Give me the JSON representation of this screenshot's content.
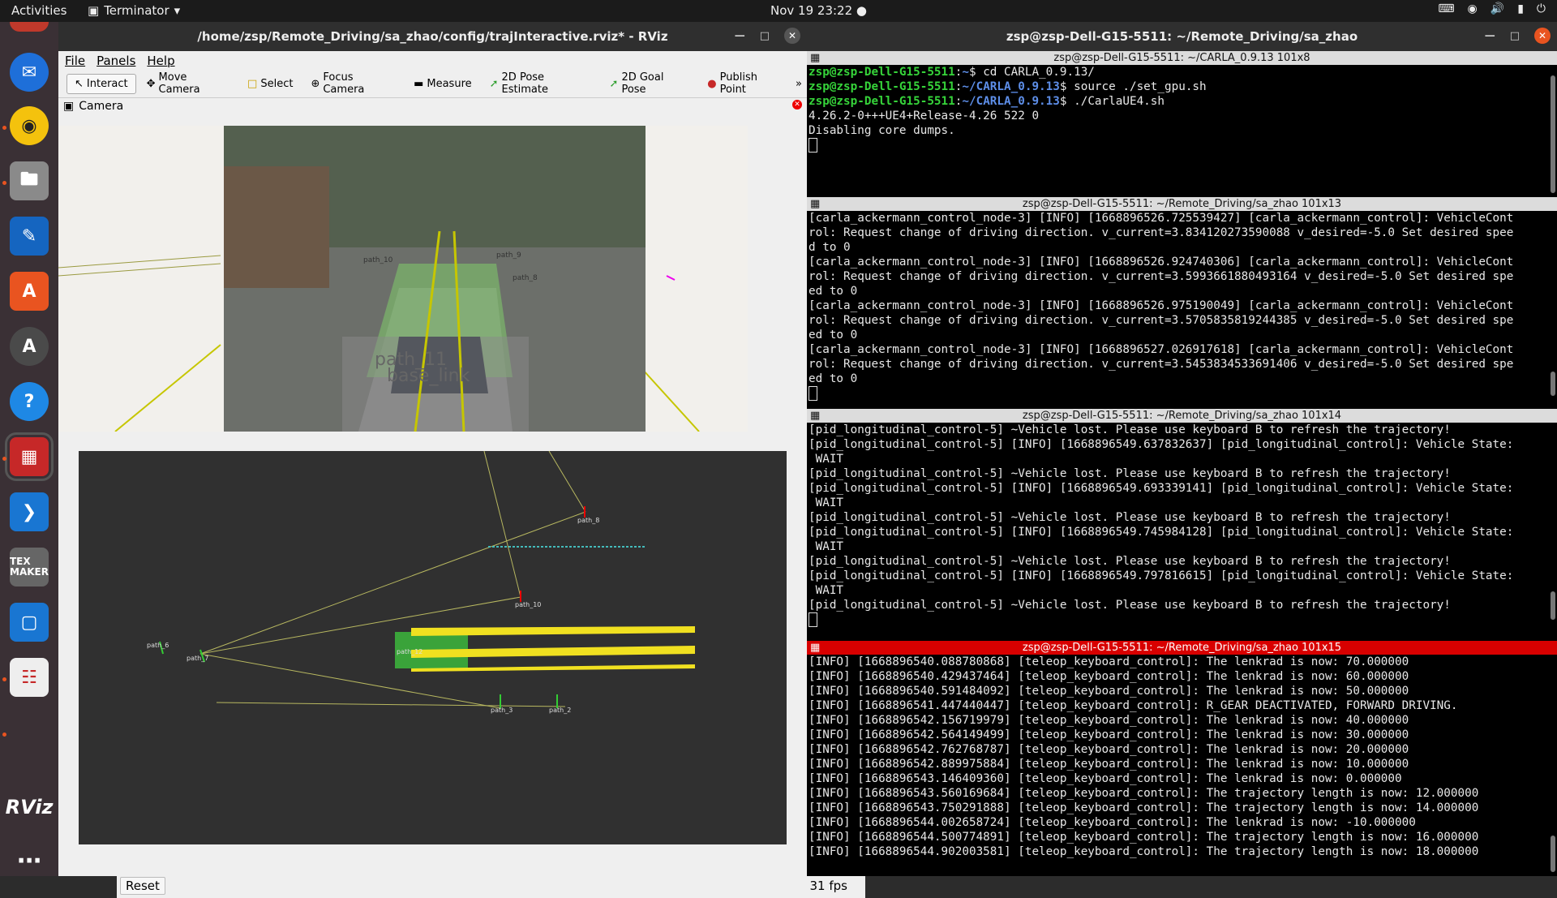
{
  "topbar": {
    "activities": "Activities",
    "app": "Terminator",
    "clock": "Nov 19  23:22"
  },
  "dock": {
    "items": [
      "thunderbird-icon",
      "rhythmbox-icon",
      "files-icon",
      "libreoffice-writer-icon",
      "software-center-icon",
      "software-updater-icon",
      "help-icon",
      "terminator-icon",
      "vscode-icon",
      "texmaker-icon",
      "screenshot-icon",
      "document-viewer-icon",
      "rviz-icon",
      "app-grid-icon"
    ],
    "rviz_label": "RViz",
    "texmaker_label": "TEX MAKER"
  },
  "rviz": {
    "title": "/home/zsp/Remote_Driving/sa_zhao/config/trajInteractive.rviz* - RViz",
    "menu": [
      "File",
      "Panels",
      "Help"
    ],
    "tools": [
      "Interact",
      "Move Camera",
      "Select",
      "Focus Camera",
      "Measure",
      "2D Pose Estimate",
      "2D Goal Pose",
      "Publish Point"
    ],
    "camera_panel_title": "Camera",
    "camera_labels": {
      "path_10": "path_10",
      "path_9": "path_9",
      "path_8": "path_8",
      "path_11": "path_11",
      "base_link": "base_link"
    },
    "scene_labels": {
      "path_8": "path_8",
      "path_10": "path_10",
      "path_6": "path_6",
      "path_7": "path_7",
      "path_3": "path_3",
      "path_2": "path_2",
      "path_12": "path_12"
    },
    "reset": "Reset",
    "fps": "31 fps"
  },
  "terminal": {
    "title": "zsp@zsp-Dell-G15-5511: ~/Remote_Driving/sa_zhao",
    "pane1": {
      "title": "zsp@zsp-Dell-G15-5511: ~/CARLA_0.9.13 101x8",
      "lines": [
        {
          "user": "zsp@zsp-Dell-G15-5511",
          "path": "~",
          "cmd": "$ cd CARLA_0.9.13/"
        },
        {
          "user": "zsp@zsp-Dell-G15-5511",
          "path": "~/CARLA_0.9.13",
          "cmd": "$ source ./set_gpu.sh"
        },
        {
          "user": "zsp@zsp-Dell-G15-5511",
          "path": "~/CARLA_0.9.13",
          "cmd": "$ ./CarlaUE4.sh"
        }
      ],
      "output": [
        "4.26.2-0+++UE4+Release-4.26 522 0",
        "Disabling core dumps."
      ]
    },
    "pane2": {
      "title": "zsp@zsp-Dell-G15-5511: ~/Remote_Driving/sa_zhao 101x13",
      "lines": [
        "[carla_ackermann_control_node-3] [INFO] [1668896526.725539427] [carla_ackermann_control]: VehicleCont",
        "rol: Request change of driving direction. v_current=3.834120273590088 v_desired=-5.0 Set desired spee",
        "d to 0",
        "[carla_ackermann_control_node-3] [INFO] [1668896526.924740306] [carla_ackermann_control]: VehicleCont",
        "rol: Request change of driving direction. v_current=3.5993661880493164 v_desired=-5.0 Set desired spe",
        "ed to 0",
        "[carla_ackermann_control_node-3] [INFO] [1668896526.975190049] [carla_ackermann_control]: VehicleCont",
        "rol: Request change of driving direction. v_current=3.5705835819244385 v_desired=-5.0 Set desired spe",
        "ed to 0",
        "[carla_ackermann_control_node-3] [INFO] [1668896527.026917618] [carla_ackermann_control]: VehicleCont",
        "rol: Request change of driving direction. v_current=3.5453834533691406 v_desired=-5.0 Set desired spe",
        "ed to 0"
      ]
    },
    "pane3": {
      "title": "zsp@zsp-Dell-G15-5511: ~/Remote_Driving/sa_zhao 101x14",
      "lines": [
        "[pid_longitudinal_control-5] ~Vehicle lost. Please use keyboard B to refresh the trajectory!",
        "[pid_longitudinal_control-5] [INFO] [1668896549.637832637] [pid_longitudinal_control]: Vehicle State:",
        " WAIT",
        "[pid_longitudinal_control-5] ~Vehicle lost. Please use keyboard B to refresh the trajectory!",
        "[pid_longitudinal_control-5] [INFO] [1668896549.693339141] [pid_longitudinal_control]: Vehicle State:",
        " WAIT",
        "[pid_longitudinal_control-5] ~Vehicle lost. Please use keyboard B to refresh the trajectory!",
        "[pid_longitudinal_control-5] [INFO] [1668896549.745984128] [pid_longitudinal_control]: Vehicle State:",
        " WAIT",
        "[pid_longitudinal_control-5] ~Vehicle lost. Please use keyboard B to refresh the trajectory!",
        "[pid_longitudinal_control-5] [INFO] [1668896549.797816615] [pid_longitudinal_control]: Vehicle State:",
        " WAIT",
        "[pid_longitudinal_control-5] ~Vehicle lost. Please use keyboard B to refresh the trajectory!"
      ]
    },
    "pane4": {
      "title": "zsp@zsp-Dell-G15-5511: ~/Remote_Driving/sa_zhao 101x15",
      "lines": [
        "[INFO] [1668896540.088780868] [teleop_keyboard_control]: The lenkrad is now: 70.000000",
        "[INFO] [1668896540.429437464] [teleop_keyboard_control]: The lenkrad is now: 60.000000",
        "[INFO] [1668896540.591484092] [teleop_keyboard_control]: The lenkrad is now: 50.000000",
        "[INFO] [1668896541.447440447] [teleop_keyboard_control]: R_GEAR DEACTIVATED, FORWARD DRIVING.",
        "[INFO] [1668896542.156719979] [teleop_keyboard_control]: The lenkrad is now: 40.000000",
        "[INFO] [1668896542.564149499] [teleop_keyboard_control]: The lenkrad is now: 30.000000",
        "[INFO] [1668896542.762768787] [teleop_keyboard_control]: The lenkrad is now: 20.000000",
        "[INFO] [1668896542.889975884] [teleop_keyboard_control]: The lenkrad is now: 10.000000",
        "[INFO] [1668896543.146409360] [teleop_keyboard_control]: The lenkrad is now: 0.000000",
        "[INFO] [1668896543.560169684] [teleop_keyboard_control]: The trajectory length is now: 12.000000",
        "[INFO] [1668896543.750291888] [teleop_keyboard_control]: The trajectory length is now: 14.000000",
        "[INFO] [1668896544.002658724] [teleop_keyboard_control]: The lenkrad is now: -10.000000",
        "[INFO] [1668896544.500774891] [teleop_keyboard_control]: The trajectory length is now: 16.000000",
        "[INFO] [1668896544.902003581] [teleop_keyboard_control]: The trajectory length is now: 18.000000"
      ]
    }
  }
}
